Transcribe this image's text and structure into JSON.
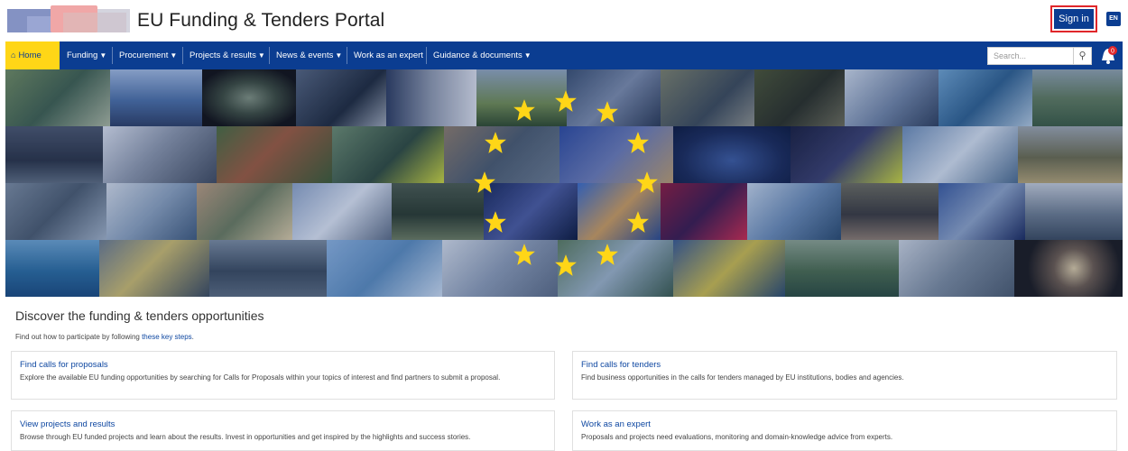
{
  "header": {
    "title": "EU Funding & Tenders Portal",
    "sign_in": "Sign in",
    "language": "EN"
  },
  "nav": {
    "home": "Home",
    "funding": "Funding",
    "procurement": "Procurement",
    "projects": "Projects & results",
    "news": "News & events",
    "expert": "Work as an expert",
    "guidance": "Guidance & documents",
    "search_placeholder": "Search...",
    "notification_count": "0"
  },
  "icons": {
    "home": "home-icon",
    "caret": "caret-down-icon",
    "search": "search-icon",
    "notification": "bell-icon"
  },
  "colors": {
    "primary": "#0b3d91",
    "accent": "#ffd617",
    "link": "#0e47a1",
    "sign_in_border": "#e0262a"
  },
  "main": {
    "heading": "Discover the funding & tenders opportunities",
    "intro_prefix": "Find out how to participate by following ",
    "intro_link": "these key steps",
    "intro_suffix": ".",
    "cards": [
      {
        "title": "Find calls for proposals",
        "desc": "Explore the available EU funding opportunities by searching for Calls for Proposals within your topics of interest and find partners to submit a proposal."
      },
      {
        "title": "Find calls for tenders",
        "desc": "Find business opportunities in the calls for tenders managed by EU institutions, bodies and agencies."
      },
      {
        "title": "View projects and results",
        "desc": "Browse through EU funded projects and learn about the results. Invest in opportunities and get inspired by the highlights and success stories."
      },
      {
        "title": "Work as an expert",
        "desc": "Proposals and projects need evaluations, monitoring and domain-knowledge advice from experts."
      }
    ]
  }
}
